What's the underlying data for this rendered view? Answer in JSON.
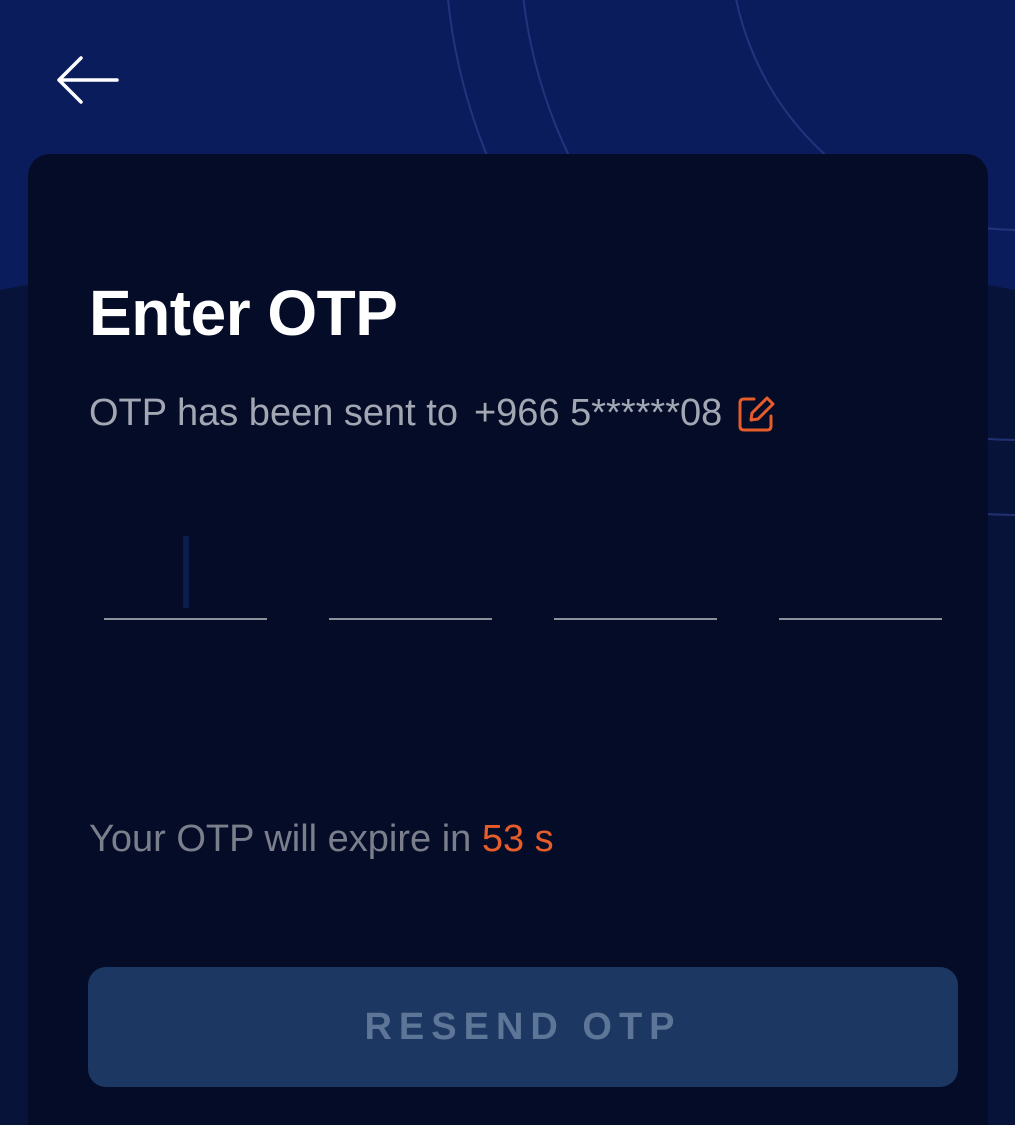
{
  "header": {
    "back_icon": "arrow-left-icon"
  },
  "otp": {
    "title": "Enter OTP",
    "sent_prefix": "OTP has been sent to",
    "phone": "+966 5******08",
    "edit_icon": "edit-pencil-icon",
    "digits": [
      "",
      "",
      "",
      ""
    ],
    "expire_prefix": "Your OTP will expire in",
    "expire_count": "53 s",
    "resend_label": "RESEND OTP"
  },
  "colors": {
    "header_bg": "#0b1c5c",
    "card_bg": "#040c27",
    "accent_orange": "#e65c2a",
    "button_bg": "#1b3762",
    "button_text": "#5d7596"
  }
}
